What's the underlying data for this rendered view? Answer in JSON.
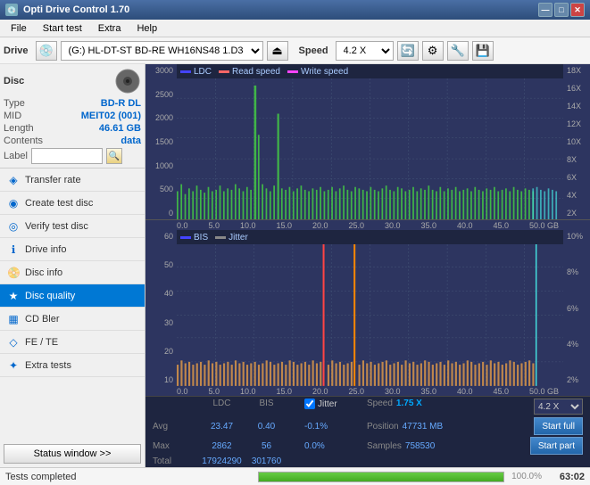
{
  "titleBar": {
    "title": "Opti Drive Control 1.70",
    "icon": "💿",
    "minimizeLabel": "—",
    "maximizeLabel": "□",
    "closeLabel": "✕"
  },
  "menuBar": {
    "items": [
      "File",
      "Start test",
      "Extra",
      "Help"
    ]
  },
  "toolbar": {
    "driveLabel": "Drive",
    "driveValue": "(G:)  HL-DT-ST BD-RE  WH16NS48 1.D3",
    "speedLabel": "Speed",
    "speedValue": "4.2 X"
  },
  "disc": {
    "title": "Disc",
    "typeLabel": "Type",
    "typeValue": "BD-R DL",
    "midLabel": "MID",
    "midValue": "MEIT02 (001)",
    "lengthLabel": "Length",
    "lengthValue": "46.61 GB",
    "contentsLabel": "Contents",
    "contentsValue": "data",
    "labelLabel": "Label"
  },
  "navItems": [
    {
      "id": "transfer-rate",
      "label": "Transfer rate",
      "icon": "◈"
    },
    {
      "id": "create-test-disc",
      "label": "Create test disc",
      "icon": "◉"
    },
    {
      "id": "verify-test-disc",
      "label": "Verify test disc",
      "icon": "◎"
    },
    {
      "id": "drive-info",
      "label": "Drive info",
      "icon": "ℹ"
    },
    {
      "id": "disc-info",
      "label": "Disc info",
      "icon": "📀"
    },
    {
      "id": "disc-quality",
      "label": "Disc quality",
      "icon": "★",
      "active": true
    },
    {
      "id": "cd-bler",
      "label": "CD Bler",
      "icon": "▦"
    },
    {
      "id": "fe-te",
      "label": "FE / TE",
      "icon": "◇"
    },
    {
      "id": "extra-tests",
      "label": "Extra tests",
      "icon": "✦"
    }
  ],
  "statusWindow": {
    "label": "Status window >>"
  },
  "statusBar": {
    "text": "Tests completed",
    "progress": 100,
    "time": "63:02"
  },
  "chart": {
    "title": "Disc quality",
    "topChart": {
      "title": "LDC",
      "legends": [
        {
          "label": "LDC",
          "color": "#4444ff"
        },
        {
          "label": "Read speed",
          "color": "#ff6666"
        },
        {
          "label": "Write speed",
          "color": "#ff44ff"
        }
      ],
      "yAxisLeft": [
        "3000",
        "2500",
        "2000",
        "1500",
        "1000",
        "500",
        "0"
      ],
      "yAxisRight": [
        "18X",
        "16X",
        "14X",
        "12X",
        "10X",
        "8X",
        "6X",
        "4X",
        "2X"
      ],
      "xAxisLabels": [
        "0.0",
        "5.0",
        "10.0",
        "15.0",
        "20.0",
        "25.0",
        "30.0",
        "35.0",
        "40.0",
        "45.0",
        "50.0 GB"
      ]
    },
    "bottomChart": {
      "title": "BIS",
      "legends": [
        {
          "label": "BIS",
          "color": "#4444ff"
        },
        {
          "label": "Jitter",
          "color": "#888888"
        }
      ],
      "yAxisLeft": [
        "60",
        "50",
        "40",
        "30",
        "20",
        "10"
      ],
      "yAxisRight": [
        "10%",
        "8%",
        "6%",
        "4%",
        "2%"
      ],
      "xAxisLabels": [
        "0.0",
        "5.0",
        "10.0",
        "15.0",
        "20.0",
        "25.0",
        "30.0",
        "35.0",
        "40.0",
        "45.0",
        "50.0 GB"
      ]
    },
    "stats": {
      "ldcLabel": "LDC",
      "bisLabel": "BIS",
      "jitterLabel": "Jitter",
      "speedLabel": "Speed",
      "speedValue": "1.75 X",
      "avgLabel": "Avg",
      "ldcAvg": "23.47",
      "bisAvg": "0.40",
      "jitterAvg": "-0.1%",
      "maxLabel": "Max",
      "ldcMax": "2862",
      "bisMax": "56",
      "jitterMax": "0.0%",
      "totalLabel": "Total",
      "ldcTotal": "17924290",
      "bisTotal": "301760",
      "positionLabel": "Position",
      "positionValue": "47731 MB",
      "samplesLabel": "Samples",
      "samplesValue": "758530",
      "speedSelectValue": "4.2 X",
      "startFullLabel": "Start full",
      "startPartLabel": "Start part"
    }
  }
}
